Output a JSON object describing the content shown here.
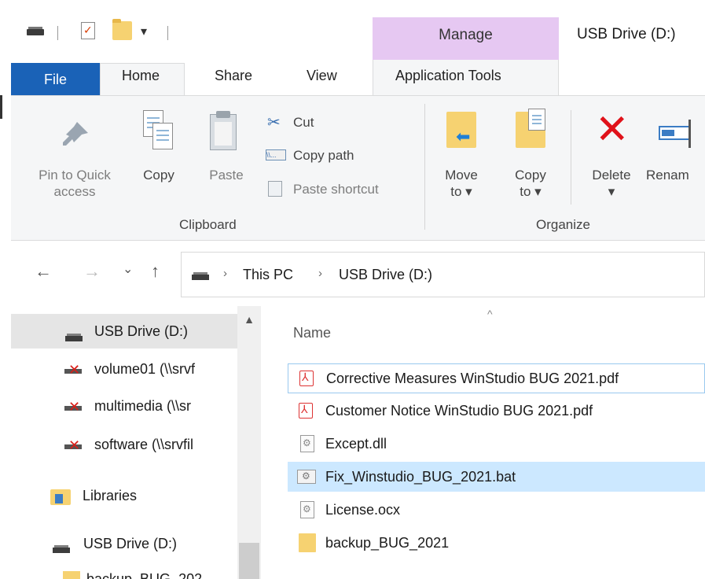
{
  "titlebar": {
    "contextual_group": "Manage",
    "window_title": "USB Drive (D:)"
  },
  "tabs": {
    "file": "File",
    "home": "Home",
    "share": "Share",
    "view": "View",
    "application_tools": "Application Tools"
  },
  "ribbon": {
    "clipboard": {
      "group_label": "Clipboard",
      "pin_line1": "Pin to Quick",
      "pin_line2": "access",
      "copy": "Copy",
      "paste": "Paste",
      "cut": "Cut",
      "copy_path": "Copy path",
      "paste_shortcut": "Paste shortcut"
    },
    "organize": {
      "group_label": "Organize",
      "move_line1": "Move",
      "move_line2": "to ▾",
      "copy_line1": "Copy",
      "copy_line2": "to ▾",
      "delete": "Delete",
      "delete_arrow": "▾",
      "rename": "Renam"
    }
  },
  "address": {
    "back_icon": "←",
    "forward_icon": "→",
    "recent_icon": "⌄",
    "up_icon": "↑",
    "crumbs": [
      "This PC",
      "USB Drive (D:)"
    ],
    "separator": "›"
  },
  "navpane": {
    "items": [
      {
        "label": "USB Drive (D:)",
        "icon": "drive-icon",
        "selected": true
      },
      {
        "label": "volume01 (\\\\srvf",
        "icon": "network-drive-disconnected-icon"
      },
      {
        "label": "multimedia (\\\\sr",
        "icon": "network-drive-disconnected-icon"
      },
      {
        "label": "software (\\\\srvfil",
        "icon": "network-drive-disconnected-icon"
      },
      {
        "label": "Libraries",
        "icon": "libraries-icon"
      },
      {
        "label": "USB Drive (D:)",
        "icon": "drive-icon"
      },
      {
        "label": "backup_BUG_202",
        "icon": "folder-icon"
      }
    ],
    "scroll_up": "▲"
  },
  "filelist": {
    "column_name": "Name",
    "sort_indicator": "^",
    "files": [
      {
        "name": "Corrective Measures WinStudio BUG 2021.pdf",
        "type": "pdf"
      },
      {
        "name": "Customer Notice WinStudio BUG 2021.pdf",
        "type": "pdf"
      },
      {
        "name": "Except.dll",
        "type": "dll"
      },
      {
        "name": "Fix_Winstudio_BUG_2021.bat",
        "type": "bat"
      },
      {
        "name": "License.ocx",
        "type": "ocx"
      },
      {
        "name": "backup_BUG_2021",
        "type": "folder"
      }
    ]
  },
  "colors": {
    "file_tab": "#1a62b7",
    "manage_tab": "#e6c8f2",
    "selection": "#cce8ff",
    "delete_red": "#e0121a",
    "folder": "#f6d271"
  }
}
